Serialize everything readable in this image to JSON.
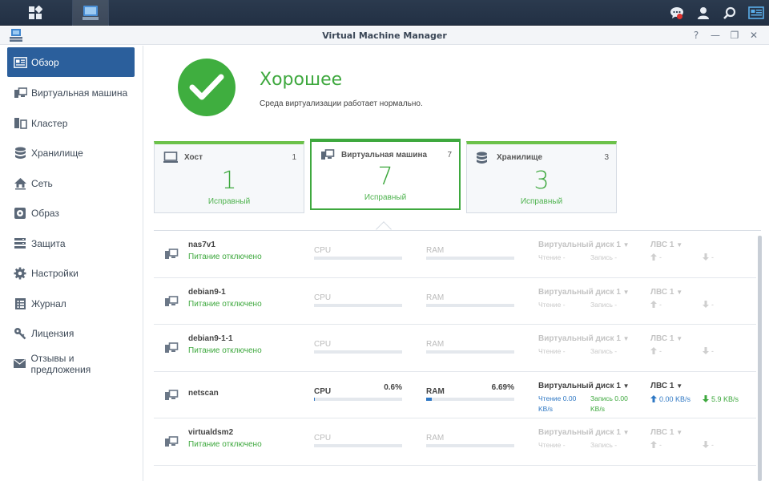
{
  "window": {
    "title": "Virtual Machine Manager"
  },
  "taskbar": {
    "icons": [
      "main-menu-icon",
      "vmm-app-icon",
      "chat-icon",
      "user-icon",
      "search-icon",
      "widgets-icon"
    ]
  },
  "sidebar": {
    "items": [
      {
        "label": "Обзор",
        "icon": "overview-icon",
        "active": true
      },
      {
        "label": "Виртуальная машина",
        "icon": "vm-icon"
      },
      {
        "label": "Кластер",
        "icon": "cluster-icon"
      },
      {
        "label": "Хранилище",
        "icon": "storage-icon"
      },
      {
        "label": "Сеть",
        "icon": "network-icon"
      },
      {
        "label": "Образ",
        "icon": "image-icon"
      },
      {
        "label": "Защита",
        "icon": "protection-icon"
      },
      {
        "label": "Настройки",
        "icon": "settings-icon"
      },
      {
        "label": "Журнал",
        "icon": "log-icon"
      },
      {
        "label": "Лицензия",
        "icon": "license-icon"
      },
      {
        "label": "Отзывы и предложения",
        "icon": "feedback-icon"
      }
    ]
  },
  "status": {
    "title": "Хорошее",
    "description": "Среда виртуализации работает нормально."
  },
  "cards": [
    {
      "label": "Хост",
      "count": "1",
      "big": "1",
      "sub": "Исправный"
    },
    {
      "label": "Виртуальная машина",
      "count": "7",
      "big": "7",
      "sub": "Исправный"
    },
    {
      "label": "Хранилище",
      "count": "3",
      "big": "3",
      "sub": "Исправный"
    }
  ],
  "columns": {
    "cpu": "CPU",
    "ram": "RAM",
    "disk": "Виртуальный диск 1",
    "lan": "ЛВС 1",
    "read": "Чтение",
    "write": "Запись",
    "dash": "-"
  },
  "vms": [
    {
      "name": "nas7v1",
      "power": "Питание отключено"
    },
    {
      "name": "debian9-1",
      "power": "Питание отключено"
    },
    {
      "name": "debian9-1-1",
      "power": "Питание отключено"
    },
    {
      "name": "netscan",
      "cpu": "0.6%",
      "cpu_pct": 0.6,
      "ram": "6.69%",
      "ram_pct": 6.69,
      "read": "0.00 KB/s",
      "write": "0.00 KB/s",
      "up": "0.00 KB/s",
      "down": "5.9 KB/s"
    },
    {
      "name": "virtualdsm2",
      "power": "Питание отключено"
    }
  ]
}
